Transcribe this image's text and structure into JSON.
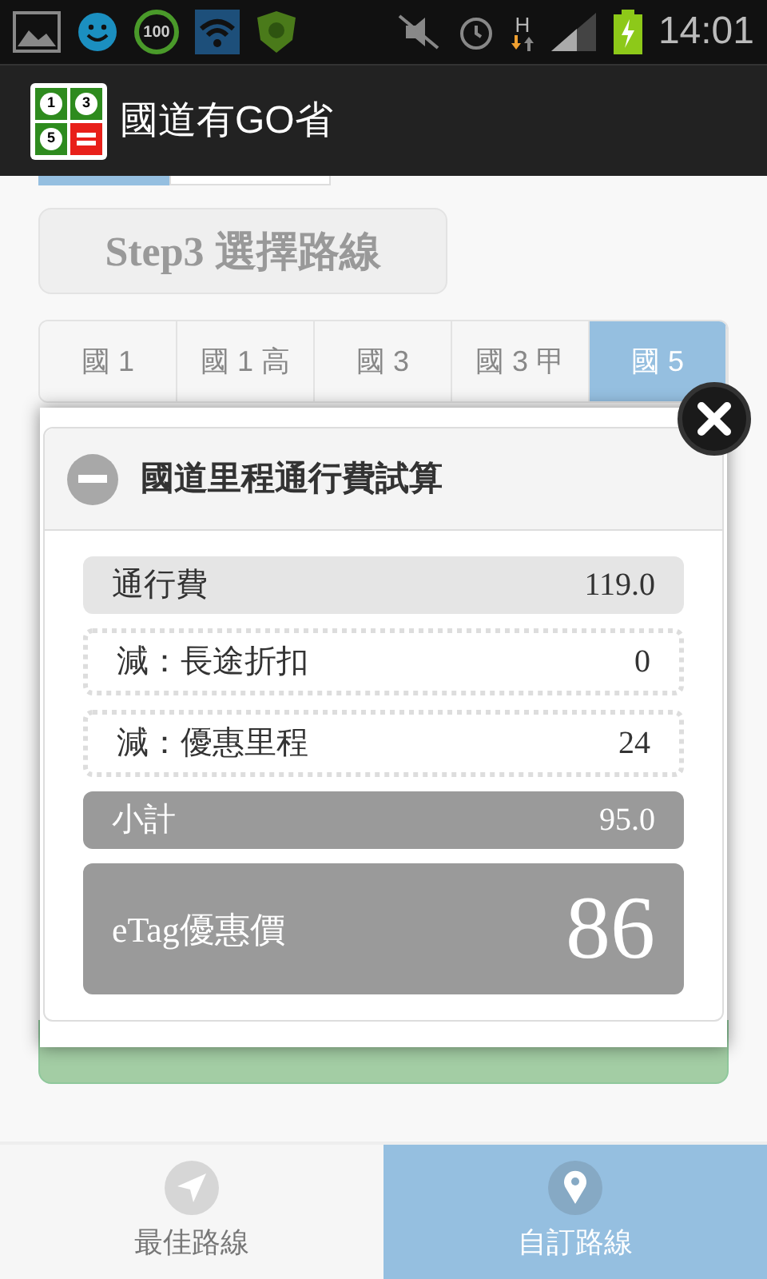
{
  "status_bar": {
    "badge": "100",
    "network_type": "H",
    "time": "14:01"
  },
  "app_bar": {
    "logo_marks": [
      "1",
      "3",
      "5"
    ],
    "title": "國道有GO省"
  },
  "step_button": "Step3 選擇路線",
  "tabs": [
    {
      "label": "國 1",
      "selected": false
    },
    {
      "label": "國 1 高",
      "selected": false
    },
    {
      "label": "國 3",
      "selected": false
    },
    {
      "label": "國 3 甲",
      "selected": false
    },
    {
      "label": "國 5",
      "selected": true
    }
  ],
  "dialog": {
    "title": "國道里程通行費試算",
    "expanded": true,
    "rows": [
      {
        "kind": "plain",
        "label": "通行費",
        "value": "119.0"
      },
      {
        "kind": "dashed",
        "label": "減：長途折扣",
        "value": "0"
      },
      {
        "kind": "dashed",
        "label": "減：優惠里程",
        "value": "24"
      },
      {
        "kind": "subtotal",
        "label": "小計",
        "value": "95.0"
      },
      {
        "kind": "total",
        "label": "eTag優惠價",
        "value": "86"
      }
    ]
  },
  "bottom_nav": [
    {
      "label": "最佳路線",
      "kind": "navigate",
      "selected": false
    },
    {
      "label": "自訂路線",
      "kind": "pin",
      "selected": true
    }
  ]
}
